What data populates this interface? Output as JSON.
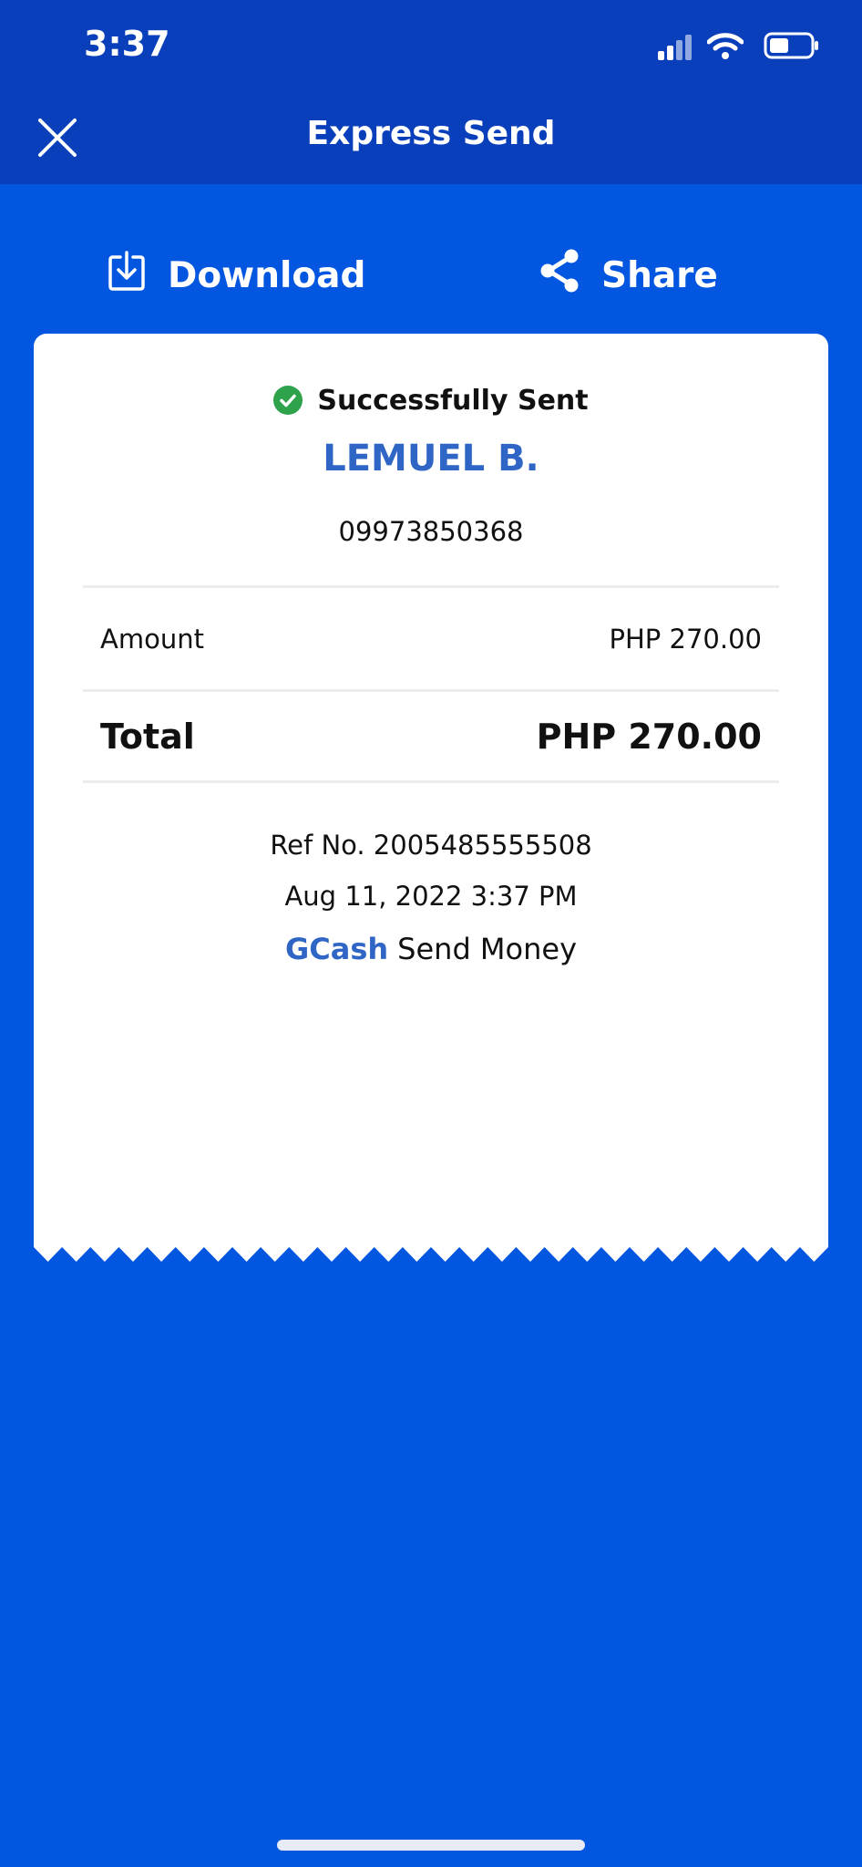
{
  "status_bar": {
    "time": "3:37"
  },
  "nav": {
    "title": "Express Send"
  },
  "actions": {
    "download_label": "Download",
    "share_label": "Share"
  },
  "receipt": {
    "status_text": "Successfully Sent",
    "recipient_name": "LEMUEL B.",
    "recipient_number": "09973850368",
    "amount_label": "Amount",
    "amount_value": "PHP 270.00",
    "total_label": "Total",
    "total_value": "PHP 270.00",
    "ref_line": "Ref No. 2005485555508",
    "datetime": "Aug 11, 2022 3:37 PM",
    "brand_name": "GCash",
    "brand_service": "Send Money"
  },
  "colors": {
    "background": "#0356e0",
    "header": "#0a3fbb",
    "accent_text": "#2f66c5",
    "success": "#2fa34c"
  }
}
